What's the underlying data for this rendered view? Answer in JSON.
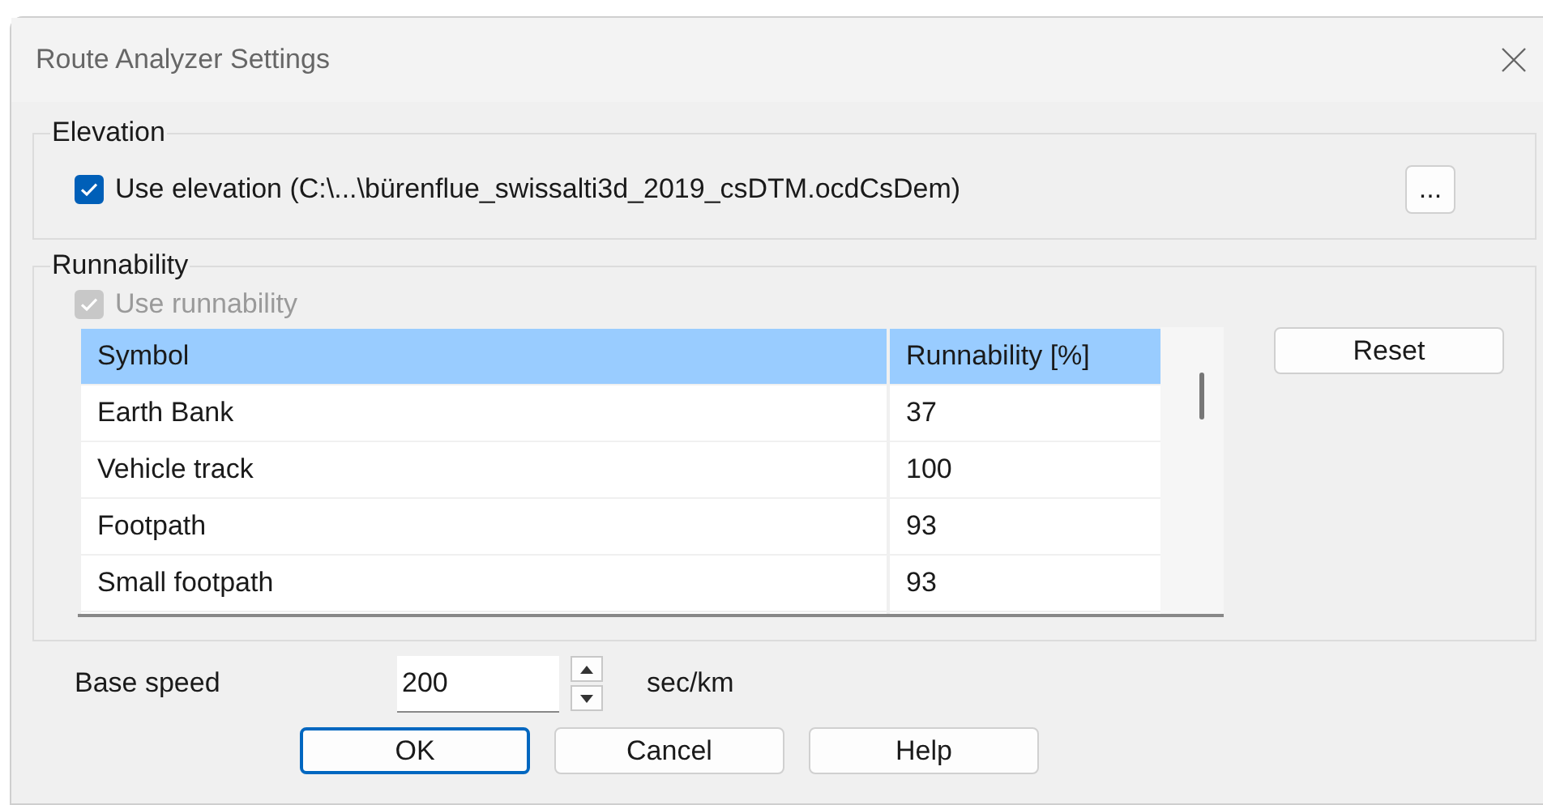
{
  "window": {
    "title": "Route Analyzer Settings"
  },
  "elevation": {
    "label": "Elevation",
    "use_elevation": {
      "label": "Use elevation (C:\\...\\bürenflue_swissalti3d_2019_csDTM.ocdCsDem)",
      "checked": true,
      "disabled": false
    },
    "browse_button": "..."
  },
  "runnability": {
    "label": "Runnability",
    "use_runnability": {
      "label": "Use runnability",
      "checked": true,
      "disabled": true
    },
    "table": {
      "columns": [
        "Symbol",
        "Runnability [%]"
      ],
      "rows": [
        [
          "Earth Bank",
          "37"
        ],
        [
          "Vehicle track",
          "100"
        ],
        [
          "Footpath",
          "93"
        ],
        [
          "Small footpath",
          "93"
        ]
      ]
    },
    "reset_button": "Reset"
  },
  "base_speed": {
    "label": "Base speed",
    "value": "200",
    "unit": "sec/km"
  },
  "buttons": [
    {
      "label": "OK",
      "default": true
    },
    {
      "label": "Cancel",
      "default": false
    },
    {
      "label": "Help",
      "default": false
    }
  ]
}
